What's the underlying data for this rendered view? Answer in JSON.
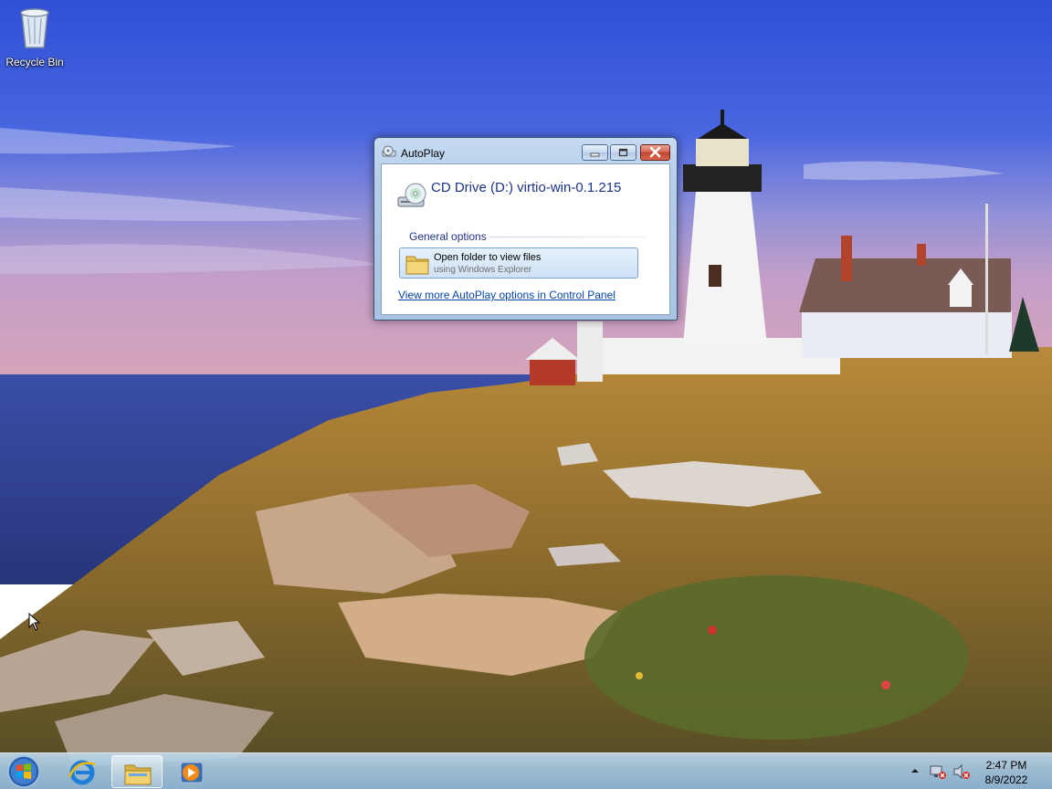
{
  "desktop": {
    "icons": [
      {
        "label": "Recycle Bin",
        "icon": "recycle-bin-icon"
      }
    ]
  },
  "autoplay": {
    "window_title": "AutoPlay",
    "drive_title": "CD Drive (D:) virtio-win-0.1.215",
    "section_label": "General options",
    "option": {
      "title": "Open folder to view files",
      "subtitle": "using Windows Explorer",
      "icon": "folder-icon"
    },
    "control_panel_link": "View more AutoPlay options in Control Panel"
  },
  "taskbar": {
    "pinned": [
      "start-orb",
      "internet-explorer-icon",
      "windows-explorer-icon",
      "media-player-icon"
    ],
    "active_item": "windows-explorer-icon",
    "clock": {
      "time": "2:47 PM",
      "date": "8/9/2022"
    },
    "tray": [
      "show-hidden-icons-arrow",
      "network-icon",
      "volume-muted-icon"
    ]
  },
  "colors": {
    "link": "#0645ad",
    "heading": "#1e3287",
    "close_button": "#c2432f"
  }
}
